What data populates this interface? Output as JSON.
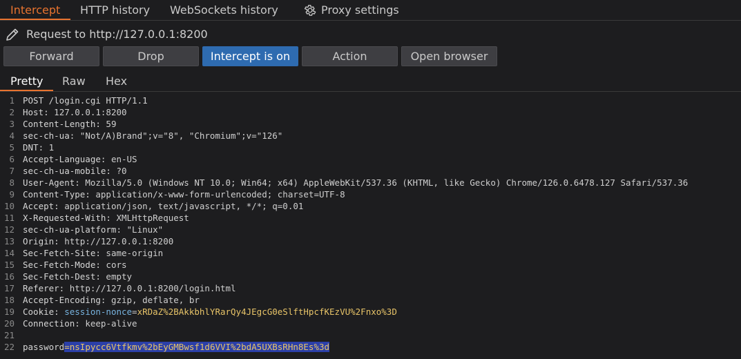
{
  "tabs": [
    {
      "label": "Intercept",
      "active": true
    },
    {
      "label": "HTTP history",
      "active": false
    },
    {
      "label": "WebSockets history",
      "active": false
    },
    {
      "label": "Proxy settings",
      "active": false
    }
  ],
  "request": {
    "label": "Request to http://127.0.0.1:8200"
  },
  "buttons": {
    "forward": "Forward",
    "drop": "Drop",
    "intercept": "Intercept is on",
    "action": "Action",
    "open_browser": "Open browser"
  },
  "view_tabs": [
    {
      "label": "Pretty",
      "active": true
    },
    {
      "label": "Raw",
      "active": false
    },
    {
      "label": "Hex",
      "active": false
    }
  ],
  "lines": [
    {
      "n": "1",
      "text": "POST /login.cgi HTTP/1.1"
    },
    {
      "n": "2",
      "key": "Host:",
      "val": " 127.0.0.1:8200"
    },
    {
      "n": "3",
      "key": "Content-Length:",
      "val": " 59"
    },
    {
      "n": "4",
      "key": "sec-ch-ua:",
      "val": " \"Not/A)Brand\";v=\"8\", \"Chromium\";v=\"126\""
    },
    {
      "n": "5",
      "key": "DNT:",
      "val": " 1"
    },
    {
      "n": "6",
      "key": "Accept-Language:",
      "val": " en-US"
    },
    {
      "n": "7",
      "key": "sec-ch-ua-mobile:",
      "val": " ?0"
    },
    {
      "n": "8",
      "key": "User-Agent:",
      "val": " Mozilla/5.0 (Windows NT 10.0; Win64; x64) AppleWebKit/537.36 (KHTML, like Gecko) Chrome/126.0.6478.127 Safari/537.36"
    },
    {
      "n": "9",
      "key": "Content-Type:",
      "val": " application/x-www-form-urlencoded; charset=UTF-8"
    },
    {
      "n": "10",
      "key": "Accept:",
      "val": " application/json, text/javascript, */*; q=0.01"
    },
    {
      "n": "11",
      "key": "X-Requested-With:",
      "val": " XMLHttpRequest"
    },
    {
      "n": "12",
      "key": "sec-ch-ua-platform:",
      "val": " \"Linux\""
    },
    {
      "n": "13",
      "key": "Origin:",
      "val": " http://127.0.0.1:8200"
    },
    {
      "n": "14",
      "key": "Sec-Fetch-Site:",
      "val": " same-origin"
    },
    {
      "n": "15",
      "key": "Sec-Fetch-Mode:",
      "val": " cors"
    },
    {
      "n": "16",
      "key": "Sec-Fetch-Dest:",
      "val": " empty"
    },
    {
      "n": "17",
      "key": "Referer:",
      "val": " http://127.0.0.1:8200/login.html"
    },
    {
      "n": "18",
      "key": "Accept-Encoding:",
      "val": " gzip, deflate, br"
    },
    {
      "n": "19",
      "key": "Cookie:",
      "cookie_name": " session-nonce",
      "eq": "=",
      "cookie_val": "xRDaZ%2BAkkbhlYRarQy4JEgcG0eSlftHpcfKEzVU%2Fnxo%3D"
    },
    {
      "n": "20",
      "key": "Connection:",
      "val": " keep-alive"
    },
    {
      "n": "21",
      "text": ""
    },
    {
      "n": "22",
      "param_name": "password",
      "param_eq": "=",
      "param_val": "nsIpycc6Vtfkmv%2bEyGMBwsf1d6VVI%2bdA5UXBsRHn8Es%3d"
    }
  ],
  "colors": {
    "accent": "#e8732f",
    "primary_button": "#2e6bb0",
    "cookie_name": "#78b4e0",
    "cookie_value": "#e8c468",
    "selection": "#2b3fa8"
  }
}
